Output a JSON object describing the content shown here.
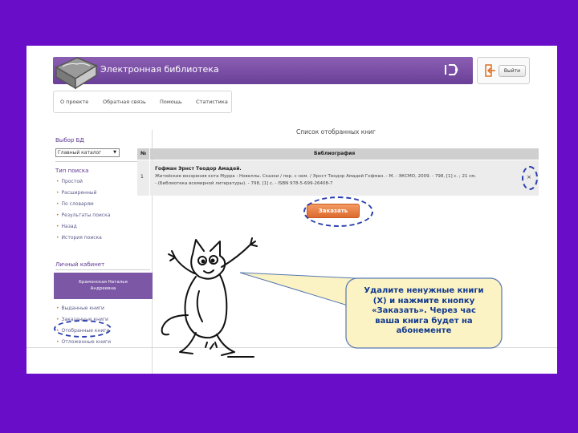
{
  "header": {
    "title": "Электронная библиотека",
    "logout_label": "Выйти"
  },
  "topnav": {
    "items": [
      "О проекте",
      "Обратная связь",
      "Помощь",
      "Статистика"
    ]
  },
  "sidebar": {
    "db_heading": "Выбор БД",
    "db_selected": "Главный каталог",
    "search_heading": "Тип поиска",
    "search_items": [
      "Простой",
      "Расширенный",
      "По словарям",
      "Результаты поиска",
      "Назад",
      "История поиска"
    ],
    "cabinet_heading": "Личный кабинет",
    "user_name_line1": "Брамонская Наталья",
    "user_name_line2": "Андреевна",
    "cabinet_items": [
      "Выданные книги",
      "Заказанные книги",
      "Отобранные книги",
      "Отложенные книги"
    ]
  },
  "main": {
    "list_title": "Список отобранных книг",
    "table": {
      "headers": [
        "№",
        "Библиография"
      ],
      "rows": [
        {
          "num": "1",
          "author": "Гофман Эрнст Теодор Амадей.",
          "bib_line1": "Житейские воззрения кота Мурра : Новеллы. Сказки / пер. с нем. / Эрнст Теодор Амадей Гофман. - М. : ЭКСМО, 2009. - 798, [1] с. ; 21 см.",
          "bib_line2": "- (Библиотека всемирной литературы). - 798, [1] с. - ISBN 978-5-699-26408-7",
          "remove": "×"
        }
      ]
    },
    "order_button": "Заказать"
  },
  "callout": {
    "lines": [
      "Удалите ненужные книги",
      "(Х) и нажмите кнопку",
      "«Заказать». Через час",
      "ваша книга будет на",
      "абонементе"
    ]
  },
  "colors": {
    "background": "#6a0dc9",
    "header": "#7a4fa5",
    "accent_orange": "#dd6a2f",
    "annotation_blue": "#2a3fb0",
    "callout_fill": "#fcf3c4"
  }
}
